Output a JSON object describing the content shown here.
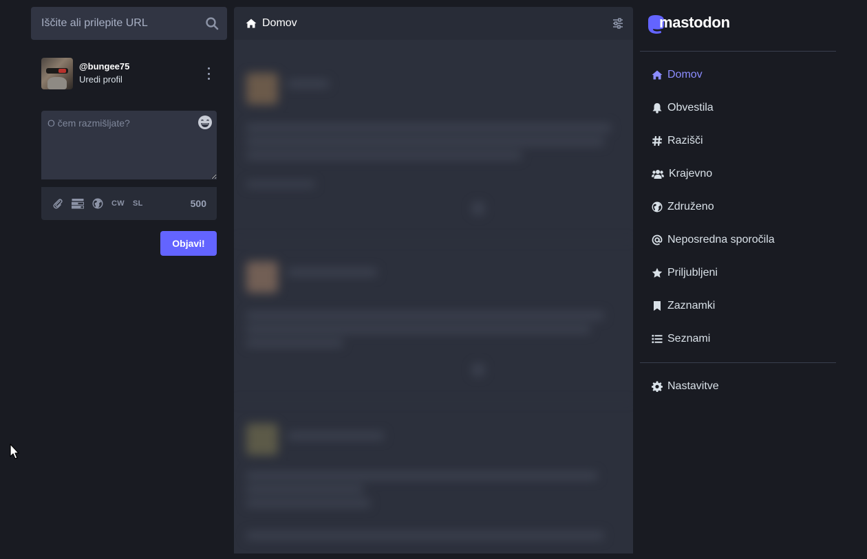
{
  "search": {
    "placeholder": "Iščite ali prilepite URL"
  },
  "account": {
    "handle": "@bungee75",
    "edit_label": "Uredi profil"
  },
  "compose": {
    "placeholder": "O čem razmišljate?",
    "cw_label": "CW",
    "lang_label": "SL",
    "char_count": "500",
    "publish_label": "Objavi!"
  },
  "column": {
    "title": "Domov"
  },
  "brand": {
    "name": "mastodon",
    "accent": "#6364ff"
  },
  "nav": {
    "items": [
      {
        "label": "Domov",
        "icon": "home-icon"
      },
      {
        "label": "Obvestila",
        "icon": "bell-icon"
      },
      {
        "label": "Razišči",
        "icon": "hashtag-icon"
      },
      {
        "label": "Krajevno",
        "icon": "users-icon"
      },
      {
        "label": "Združeno",
        "icon": "globe-icon"
      },
      {
        "label": "Neposredna sporočila",
        "icon": "at-icon"
      },
      {
        "label": "Priljubljeni",
        "icon": "star-icon"
      },
      {
        "label": "Zaznamki",
        "icon": "bookmark-icon"
      },
      {
        "label": "Seznami",
        "icon": "list-icon"
      }
    ],
    "settings": {
      "label": "Nastavitve",
      "icon": "gear-icon"
    }
  }
}
